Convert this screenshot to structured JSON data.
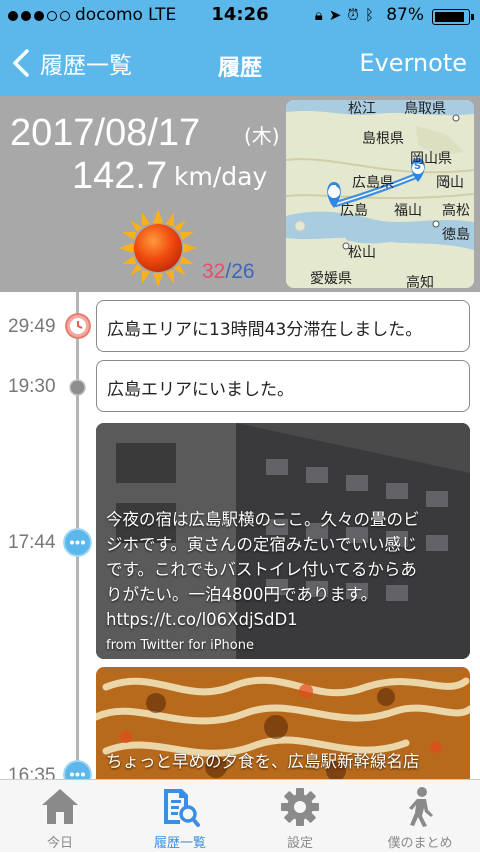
{
  "status": {
    "carrier": "docomo",
    "network": "LTE",
    "time": "14:26",
    "battery": "87%"
  },
  "nav": {
    "back_label": "履歴一覧",
    "title": "履歴",
    "right_action": "Evernote"
  },
  "summary": {
    "date": "2017/08/17",
    "weekday": "(木)",
    "distance": "142.7",
    "distance_unit": "km/day",
    "weather_icon": "sunny-icon",
    "temp_high": "32",
    "temp_sep": "/",
    "temp_low": "26"
  },
  "map": {
    "labels": [
      "松江",
      "鳥取県",
      "島根県",
      "岡山県",
      "広島県",
      "岡山",
      "広島",
      "福山",
      "高松",
      "徳島",
      "松山",
      "愛媛県",
      "高知"
    ],
    "start_marker": "G",
    "end_marker": "S"
  },
  "timeline": [
    {
      "time": "29:49",
      "marker": "clock-icon",
      "text": "広島エリアに13時間43分滞在しました。"
    },
    {
      "time": "19:30",
      "marker": "point-icon",
      "text": "広島エリアにいました。"
    },
    {
      "time": "17:44",
      "marker": "chat-icon",
      "lines": [
        "今夜の宿は広島駅横のここ。久々の畳のビ",
        "ジホです。寅さんの定宿みたいでいい感じ",
        "です。これでもバストイレ付いてるからあ",
        "りがたい。一泊4800円であります。",
        "https://t.co/l06XdjSdD1"
      ],
      "source": "from Twitter for iPhone"
    },
    {
      "time": "16:35",
      "marker": "chat-icon",
      "text": "ちょっと早めの夕食を、広島駅新幹線名店"
    }
  ],
  "tabs": [
    {
      "label": "今日",
      "icon": "home-icon"
    },
    {
      "label": "履歴一覧",
      "icon": "history-search-icon"
    },
    {
      "label": "設定",
      "icon": "gear-icon"
    },
    {
      "label": "僕のまとめ",
      "icon": "walking-person-icon"
    }
  ],
  "colors": {
    "nav_bar": "#5cb8ea",
    "summary_bg": "#a8a8a8",
    "temp_high": "#e0526c",
    "temp_low": "#3b68b9",
    "active_tab": "#3c8ee0",
    "route": "#2f86e0"
  }
}
